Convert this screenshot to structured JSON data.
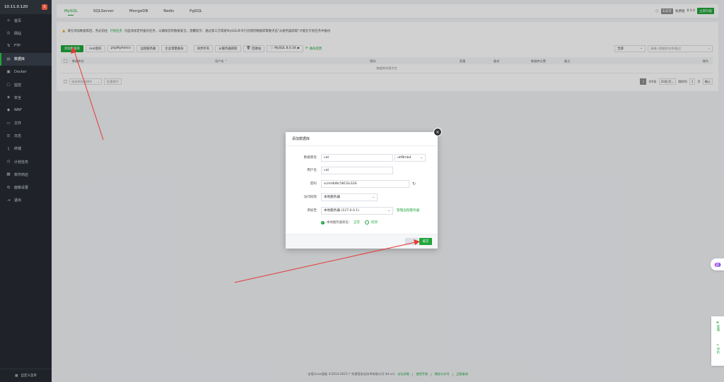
{
  "sidebar": {
    "ip": "10.11.0.120",
    "badge": "0",
    "items": [
      {
        "label": "首页",
        "icon": "home-icon"
      },
      {
        "label": "网站",
        "icon": "globe-icon"
      },
      {
        "label": "FTP",
        "icon": "ftp-icon"
      },
      {
        "label": "数据库",
        "icon": "database-icon",
        "active": true
      },
      {
        "label": "Docker",
        "icon": "docker-icon"
      },
      {
        "label": "监控",
        "icon": "monitor-icon"
      },
      {
        "label": "安全",
        "icon": "shield-icon"
      },
      {
        "label": "WAF",
        "icon": "waf-icon"
      },
      {
        "label": "文件",
        "icon": "folder-icon"
      },
      {
        "label": "日志",
        "icon": "log-icon"
      },
      {
        "label": "终端",
        "icon": "terminal-icon"
      },
      {
        "label": "计划任务",
        "icon": "clock-icon"
      },
      {
        "label": "软件商店",
        "icon": "store-icon"
      },
      {
        "label": "面板设置",
        "icon": "gear-icon"
      },
      {
        "label": "退出",
        "icon": "logout-icon"
      }
    ],
    "footer_label": "自定义菜单"
  },
  "topbar": {
    "tabs": [
      "MySQL",
      "SQLServer",
      "MongoDB",
      "Redis",
      "PgSQL"
    ],
    "active_tab": 0,
    "status_pill": "未安装",
    "edition": "免费版",
    "version": "8.0.4",
    "upgrade_label": "立即升级"
  },
  "main": {
    "notice_prefix": "请在添加数据库后，务必前往",
    "notice_link": "计划任务",
    "notice_suffix": "页面添加定时备份任务，以确保您的数据安全。温馨提示：通过第三方或者MySQL命令行创建的数据库需要点击\"从服务器获取\"才能在计划任务中备份",
    "toolbar": {
      "add_db": "添加数据库",
      "root_pwd": "root密码",
      "phpmyadmin": "phpMyAdmin",
      "remote_server": "远程服务器",
      "enterprise_backup": "企业增量备份",
      "sync_all": "同步所有",
      "fetch_from_server": "从服务器获取",
      "recycle_bin": "回收站",
      "mysql_version": "MySQL 8.0.34",
      "import_export": "备份还原",
      "filter_value": "全部",
      "search_placeholder": "请输入数据库名称/备注"
    },
    "table": {
      "headers": [
        "数据库名",
        "用户名 ⌃",
        "密码",
        "容量",
        "备份",
        "数据库位置",
        "备注",
        "操作"
      ],
      "empty_text": "数据库列表为空"
    },
    "footer": {
      "batch_select": "请选择批量操作",
      "batch_btn": "批量操作",
      "page_current": "1",
      "total": "共0条",
      "per_page": "20条/页",
      "jump_label": "跳转到",
      "jump_value": "1",
      "page_unit": "页",
      "confirm": "确认"
    }
  },
  "modal": {
    "title": "添加数据库",
    "close_glyph": "×",
    "db_name_label": "数据库名",
    "db_name_value": "cat",
    "charset": "utf8mb4",
    "user_label": "用户名",
    "user_value": "cat",
    "password_label": "密码",
    "password_value": "scmHbWc5KCGLS3S",
    "access_label": "访问权限",
    "access_value": "本地服务器",
    "add_to_label": "添加至",
    "add_to_value": "本地服务器 (127.0.0.1)",
    "manage_remote": "管理远程服务器",
    "status_text": "本地服务器状态：",
    "status_ok": "正常",
    "check_label": "检测",
    "submit_label": "提交"
  },
  "right_panel": {
    "service": "客服",
    "rate": "评价"
  },
  "footer": {
    "copyright": "宝塔Linux面板 ©2014-2023 广东堡塔安全技术有限公司 (bt.cn)",
    "forum": "论坛求助",
    "manual": "使用手册",
    "wechat": "微信公众号",
    "auth": "正版查询",
    "separator": "|"
  },
  "colors": {
    "accent": "#20a53a",
    "sidebar_bg": "#1f2329",
    "arrow": "#e53935"
  }
}
